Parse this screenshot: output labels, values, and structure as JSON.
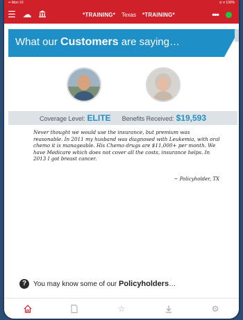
{
  "statusbar": {
    "left": "•• Mon 10",
    "right": "⊙ ▾ 100%"
  },
  "nav": {
    "training_left": "*TRAINING*",
    "state": "Texas",
    "training_right": "*TRAINING*",
    "more": "•••"
  },
  "banner": {
    "prefix": "What our ",
    "bold": "Customers",
    "suffix": " are saying…"
  },
  "coverage": {
    "level_label": "Coverage Level:",
    "level_value": "ELITE",
    "benefits_label": "Benefits Received:",
    "benefits_value": "$19,593"
  },
  "testimonial": {
    "text": "Never thought we would use the insurance, but premium was reasonable. In 2011 my husband was diagnosed with Leukemia, with oral chemo it is manageable. His Chemo drugs are $11,000+ per month. We have Medicare which does not cover all the costs, insurance helps. In 2013 I got breast cancer.",
    "signature": "~ Policyholder, TX"
  },
  "info": {
    "prefix": "You may know some of our ",
    "bold": "Policyholders",
    "suffix": "…"
  },
  "colors": {
    "brand_red": "#d0202a",
    "accent_blue": "#1f8fc7",
    "online_green": "#19c93f"
  }
}
